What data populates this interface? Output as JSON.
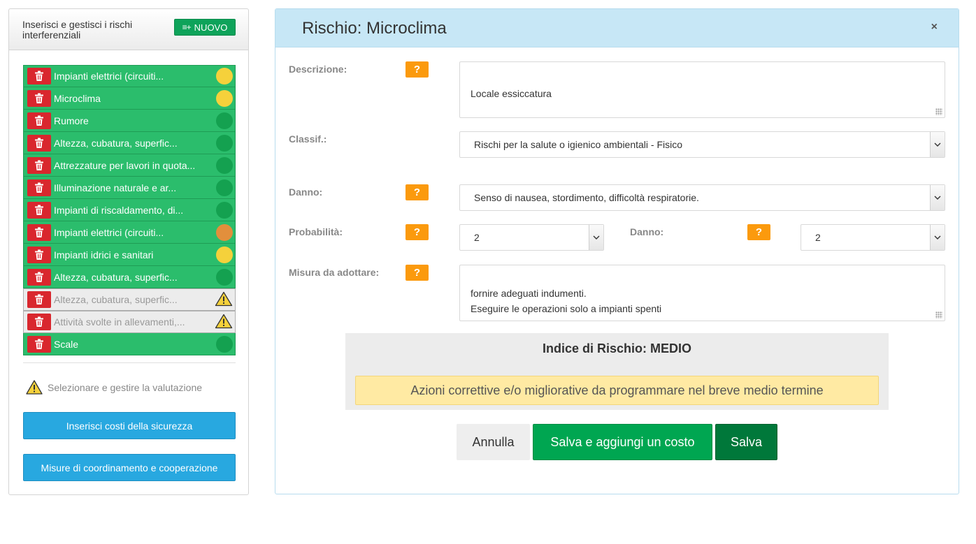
{
  "sidebar": {
    "title": "Inserisci e gestisci i rischi interferenziali",
    "new_button": "NUOVO",
    "new_button_icon": "list-add-icon",
    "items": [
      {
        "label": "Impianti elettrici (circuiti...",
        "status": "yellow"
      },
      {
        "label": "Microclima",
        "status": "yellow"
      },
      {
        "label": "Rumore",
        "status": "green"
      },
      {
        "label": "Altezza, cubatura, superfic...",
        "status": "green"
      },
      {
        "label": "Attrezzature per lavori in quota...",
        "status": "green"
      },
      {
        "label": "Illuminazione naturale e ar...",
        "status": "green"
      },
      {
        "label": "Impianti di riscaldamento, di...",
        "status": "green"
      },
      {
        "label": "Impianti elettrici (circuiti...",
        "status": "orange"
      },
      {
        "label": "Impianti idrici e sanitari",
        "status": "yellow"
      },
      {
        "label": "Altezza, cubatura, superfic...",
        "status": "green"
      },
      {
        "label": "Altezza, cubatura, superfic...",
        "status": "warning"
      },
      {
        "label": "Attività svolte in allevamenti,...",
        "status": "warning"
      },
      {
        "label": "Scale",
        "status": "green"
      }
    ],
    "hint": "Selezionare e gestire la valutazione",
    "costs_button": "Inserisci costi della sicurezza",
    "coordination_button": "Misure di coordinamento e cooperazione"
  },
  "colors": {
    "green": "#14a150",
    "yellow": "#f5d13b",
    "orange": "#e28f3c",
    "danger": "#d9272e",
    "question": "#fb9a0d"
  },
  "modal": {
    "title": "Rischio: Microclima",
    "close": "×",
    "labels": {
      "descrizione": "Descrizione:",
      "classif": "Classif.:",
      "danno": "Danno:",
      "probabilita": "Probabilità:",
      "danno2": "Danno:",
      "misura": "Misura da adottare:"
    },
    "help": "?",
    "descrizione_value": "Locale essiccatura",
    "classif_value": "Rischi per la salute o igienico ambientali - Fisico",
    "danno_value": "Senso di nausea, stordimento, difficoltà respiratorie.",
    "probabilita_value": "2",
    "danno2_value": "2",
    "misura_value": "fornire adeguati indumenti.\nEseguire le operazioni solo a impianti spenti",
    "indice": "Indice di Rischio: MEDIO",
    "azioni": "Azioni correttive e/o migliorative da programmare nel breve medio termine",
    "buttons": {
      "cancel": "Annulla",
      "save_cost": "Salva e aggiungi un costo",
      "save": "Salva"
    }
  }
}
